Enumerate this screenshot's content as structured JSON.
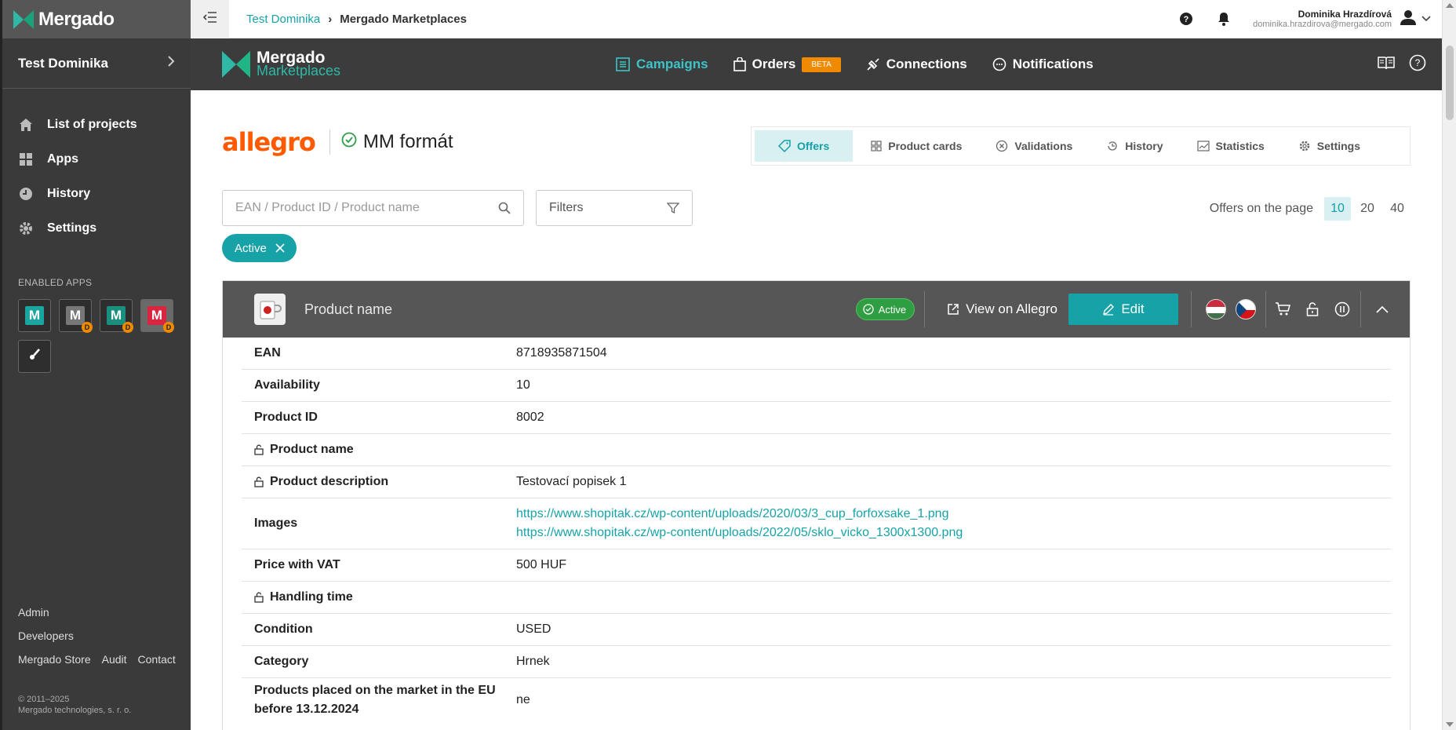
{
  "sidebar": {
    "brand": "Mergado",
    "project": "Test Dominika",
    "nav": [
      {
        "label": "List of projects",
        "icon": "home-icon"
      },
      {
        "label": "Apps",
        "icon": "apps-grid-icon"
      },
      {
        "label": "History",
        "icon": "history-icon"
      },
      {
        "label": "Settings",
        "icon": "gear-icon"
      }
    ],
    "enabled_apps_label": "ENABLED APPS",
    "apps": [
      {
        "letter": "M",
        "color": "#1aa5a0",
        "badge": ""
      },
      {
        "letter": "M",
        "color": "#777777",
        "badge": "D"
      },
      {
        "letter": "M",
        "color": "#1b8f7f",
        "badge": "D"
      },
      {
        "letter": "M",
        "color": "#d9253f",
        "badge": "D"
      }
    ],
    "footer": {
      "admin": "Admin",
      "developers": "Developers",
      "store": "Mergado Store",
      "audit": "Audit",
      "contact": "Contact",
      "copyright_years": "© 2011–2025",
      "copyright_company": "Mergado technologies, s. r. o."
    }
  },
  "topbar": {
    "breadcrumb_link": "Test Dominika",
    "breadcrumb_current": "Mergado Marketplaces",
    "user_name": "Dominika Hrazdírová",
    "user_email": "dominika.hrazdirova@mergado.com"
  },
  "appband": {
    "logo_line1": "Mergado",
    "logo_line2": "Marketplaces",
    "nav": {
      "campaigns": "Campaigns",
      "orders": "Orders",
      "orders_badge": "BETA",
      "connections": "Connections",
      "notifications": "Notifications"
    }
  },
  "page": {
    "marketplace": "allegro",
    "format": "MM formát",
    "tabs": {
      "offers": "Offers",
      "product_cards": "Product cards",
      "validations": "Validations",
      "history": "History",
      "statistics": "Statistics",
      "settings": "Settings"
    },
    "search_placeholder": "EAN / Product ID / Product name",
    "filters_label": "Filters",
    "per_page_label": "Offers on the page",
    "per_page_options": [
      "10",
      "20",
      "40"
    ],
    "active_filter_chip": "Active"
  },
  "offer": {
    "name": "Product name",
    "status": "Active",
    "view_button": "View on Allegro",
    "edit_button": "Edit",
    "rows": [
      {
        "label": "EAN",
        "value": "8718935871504",
        "locked": false
      },
      {
        "label": "Availability",
        "value": "10",
        "locked": false
      },
      {
        "label": "Product ID",
        "value": "8002",
        "locked": false
      },
      {
        "label": "Product name",
        "value": "",
        "locked": true
      },
      {
        "label": "Product description",
        "value": "Testovací popisek 1",
        "locked": true
      },
      {
        "label": "Images",
        "links": [
          "https://www.shopitak.cz/wp-content/uploads/2020/03/3_cup_forfoxsake_1.png",
          "https://www.shopitak.cz/wp-content/uploads/2022/05/sklo_vicko_1300x1300.png"
        ],
        "locked": false
      },
      {
        "label": "Price with VAT",
        "value": "500 HUF",
        "locked": false
      },
      {
        "label": "Handling time",
        "value": "",
        "locked": true
      },
      {
        "label": "Condition",
        "value": "USED",
        "locked": false
      },
      {
        "label": "Category",
        "value": "Hrnek",
        "locked": false
      },
      {
        "label_line1": "Products placed on the market in the EU",
        "label_line2": "before 13.12.2024",
        "value": "ne",
        "locked": false
      }
    ]
  }
}
